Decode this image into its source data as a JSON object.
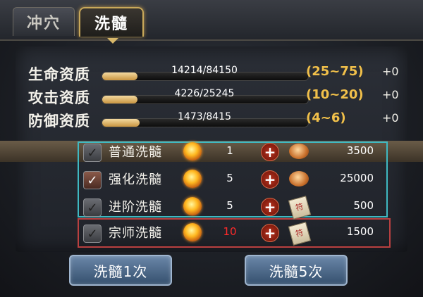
{
  "tabs": [
    {
      "label": "冲穴"
    },
    {
      "label": "洗髓"
    }
  ],
  "stats": [
    {
      "label": "生命资质",
      "current": 14214,
      "max": 84150,
      "value_text": "14214/84150",
      "range": "(25~75)",
      "bonus": "+0"
    },
    {
      "label": "攻击资质",
      "current": 4226,
      "max": 25245,
      "value_text": "4226/25245",
      "range": "(10~20)",
      "bonus": "+0"
    },
    {
      "label": "防御资质",
      "current": 1473,
      "max": 8415,
      "value_text": "1473/8415",
      "range": "(4~6)",
      "bonus": "+0"
    }
  ],
  "options": [
    {
      "name": "普通洗髓",
      "count": "1",
      "cost": "3500",
      "checked": false,
      "currency_icon": "copper-coin-icon"
    },
    {
      "name": "强化洗髓",
      "count": "5",
      "cost": "25000",
      "checked": true,
      "currency_icon": "copper-coin-icon"
    },
    {
      "name": "进阶洗髓",
      "count": "5",
      "cost": "500",
      "checked": false,
      "currency_icon": "scroll-icon"
    },
    {
      "name": "宗师洗髓",
      "count": "10",
      "cost": "1500",
      "checked": false,
      "currency_icon": "scroll-icon",
      "count_color": "#ff2a2a"
    }
  ],
  "buttons": {
    "once": "洗髓1次",
    "five": "洗髓5次"
  },
  "colors": {
    "range_text": "#f1c04a",
    "highlight_group": "#3fb9c2",
    "highlight_master": "#b94040",
    "tab_active_border": "#c9a95a"
  }
}
